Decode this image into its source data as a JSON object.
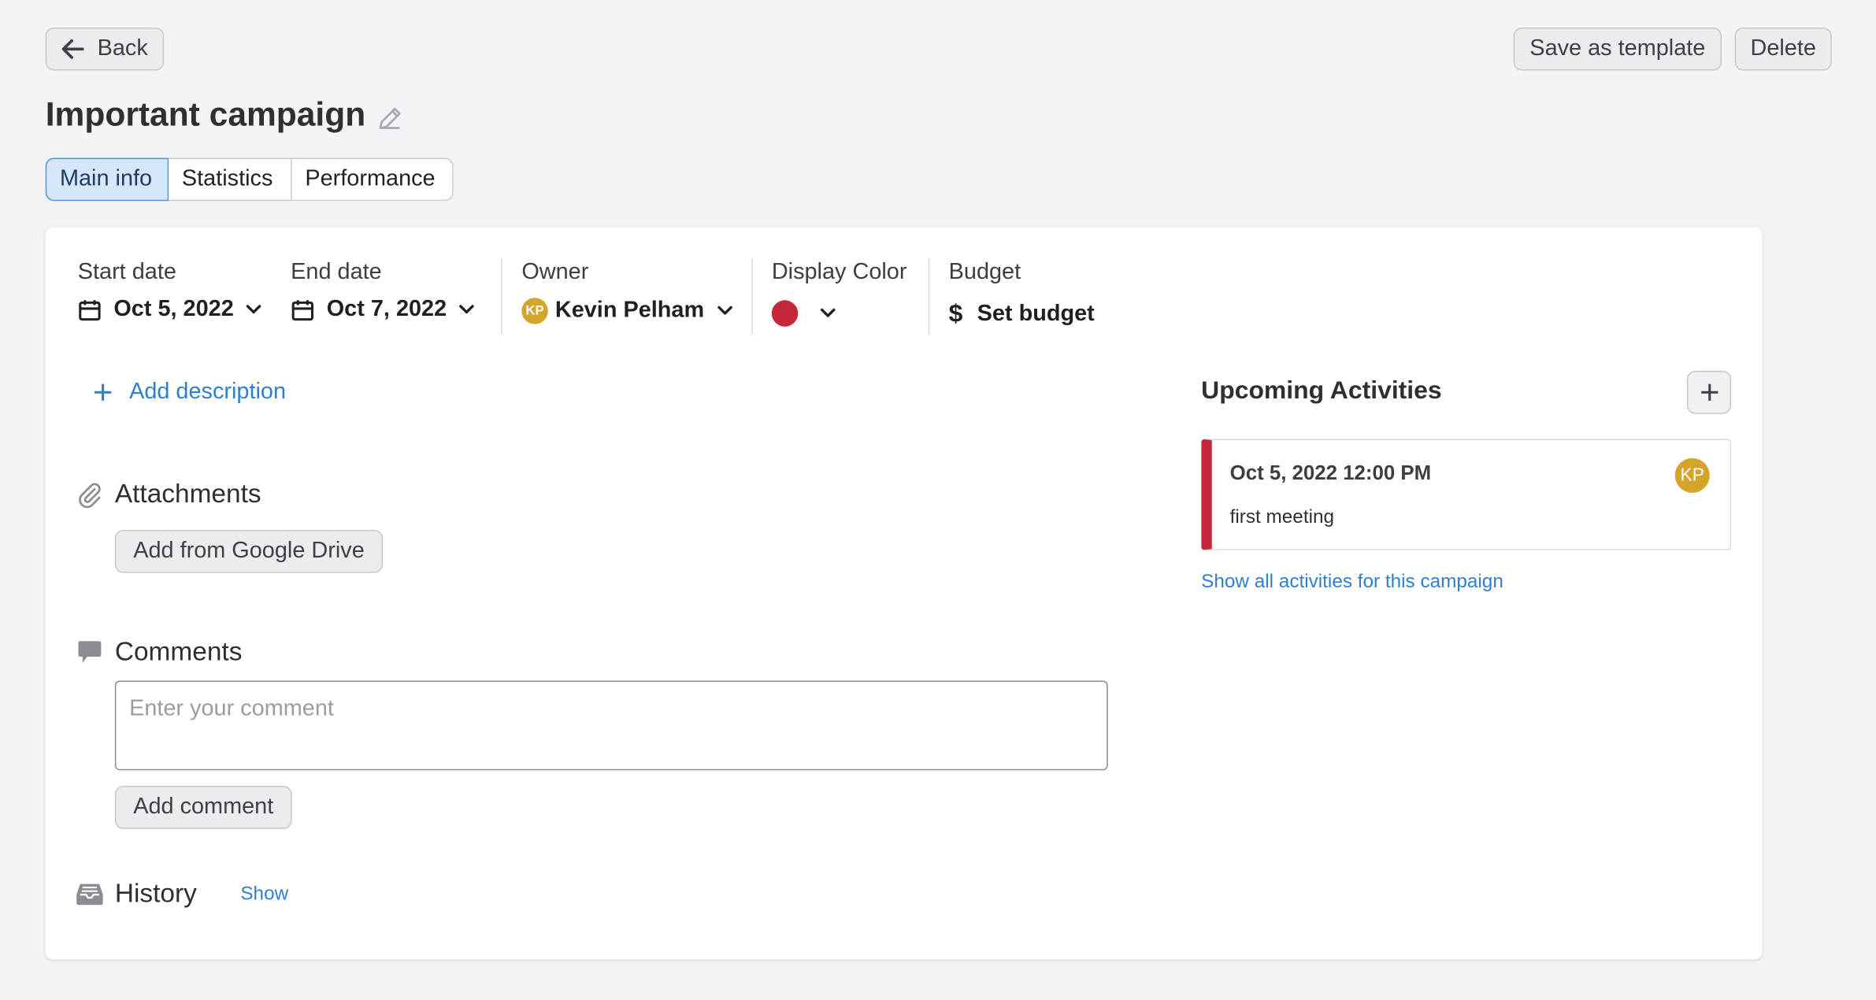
{
  "header": {
    "back_label": "Back",
    "save_template_label": "Save as template",
    "delete_label": "Delete",
    "title": "Important campaign"
  },
  "tabs": [
    {
      "label": "Main info",
      "active": true
    },
    {
      "label": "Statistics",
      "active": false
    },
    {
      "label": "Performance",
      "active": false
    }
  ],
  "fields": {
    "start_date": {
      "label": "Start date",
      "value": "Oct 5, 2022"
    },
    "end_date": {
      "label": "End date",
      "value": "Oct 7, 2022"
    },
    "owner": {
      "label": "Owner",
      "value": "Kevin Pelham",
      "initials": "KP"
    },
    "display_color": {
      "label": "Display Color",
      "color": "#c7273a"
    },
    "budget": {
      "label": "Budget",
      "value": "Set budget",
      "icon": "$"
    }
  },
  "description": {
    "add_label": "Add description"
  },
  "attachments": {
    "title": "Attachments",
    "button_label": "Add from Google Drive"
  },
  "comments": {
    "title": "Comments",
    "placeholder": "Enter your comment",
    "button_label": "Add comment"
  },
  "history": {
    "title": "History",
    "show_label": "Show"
  },
  "upcoming": {
    "title": "Upcoming Activities",
    "activities": [
      {
        "datetime": "Oct 5, 2022 12:00 PM",
        "name": "first meeting",
        "initials": "KP",
        "color": "#c7273a"
      }
    ],
    "show_all_label": "Show all activities for this campaign"
  },
  "colors": {
    "accent": "#2f7fcf",
    "tab_active_bg": "#d7e7fb",
    "avatar": "#d5a42a",
    "page_bg": "#f3f4f8"
  }
}
